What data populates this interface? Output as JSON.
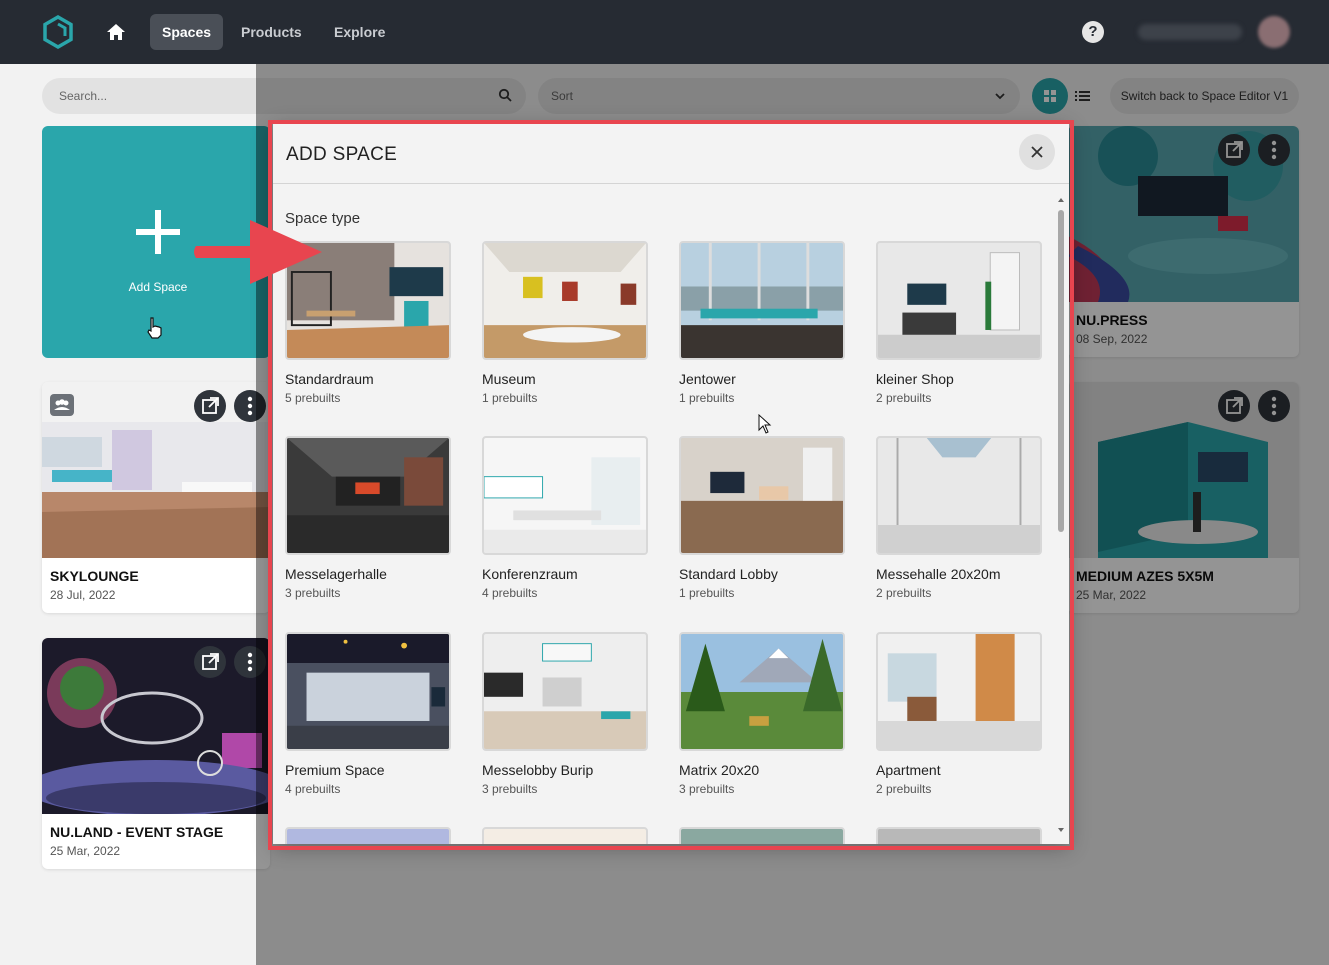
{
  "nav": {
    "items": [
      {
        "label": "Spaces",
        "active": true
      },
      {
        "label": "Products",
        "active": false
      },
      {
        "label": "Explore",
        "active": false
      }
    ],
    "accent_color": "#2aa6ab"
  },
  "toolbar": {
    "search_placeholder": "Search...",
    "sort_placeholder": "Sort",
    "switch_label": "Switch back to Space Editor V1"
  },
  "add_card": {
    "label": "Add Space"
  },
  "cards": [
    {
      "title": "SKYLOUNGE",
      "date": "28 Jul, 2022"
    },
    {
      "title": "NU.LAND - EVENT STAGE",
      "date": "25 Mar, 2022"
    },
    {
      "title": "NU.PRESS",
      "date": "08 Sep, 2022"
    },
    {
      "title": "MEDIUM AZES 5X5M",
      "date": "25 Mar, 2022"
    }
  ],
  "modal": {
    "title": "ADD SPACE",
    "close_icon": "close-icon",
    "section_title": "Space type",
    "highlight_color": "#e8454f",
    "space_types": [
      {
        "name": "Standardraum",
        "prebuilts": "5 prebuilts"
      },
      {
        "name": "Museum",
        "prebuilts": "1 prebuilts"
      },
      {
        "name": "Jentower",
        "prebuilts": "1 prebuilts"
      },
      {
        "name": "kleiner Shop",
        "prebuilts": "2 prebuilts"
      },
      {
        "name": "Messelagerhalle",
        "prebuilts": "3 prebuilts"
      },
      {
        "name": "Konferenzraum",
        "prebuilts": "4 prebuilts"
      },
      {
        "name": "Standard Lobby",
        "prebuilts": "1 prebuilts"
      },
      {
        "name": "Messehalle 20x20m",
        "prebuilts": "2 prebuilts"
      },
      {
        "name": "Premium Space",
        "prebuilts": "4 prebuilts"
      },
      {
        "name": "Messelobby Burip",
        "prebuilts": "3 prebuilts"
      },
      {
        "name": "Matrix 20x20",
        "prebuilts": "3 prebuilts"
      },
      {
        "name": "Apartment",
        "prebuilts": "2 prebuilts"
      }
    ]
  }
}
